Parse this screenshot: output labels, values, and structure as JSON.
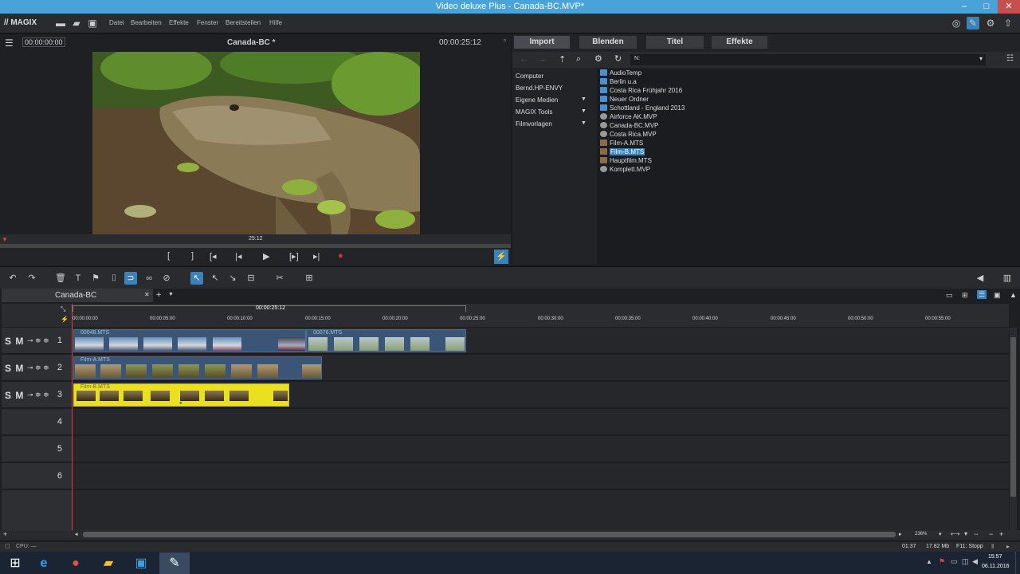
{
  "window": {
    "title": "Video deluxe Plus - Canada-BC.MVP*",
    "min": "–",
    "max": "□",
    "close": "✕"
  },
  "menubar": {
    "logo": "// MAGIX",
    "items": [
      "Datei",
      "Bearbeiten",
      "Effekte",
      "Fenster",
      "Bereitstellen",
      "Hilfe"
    ]
  },
  "preview": {
    "timecode_left": "00:00:00:00",
    "title": "Canada-BC *",
    "timecode_right": "00:00:25:12",
    "scrub_label": "25:12"
  },
  "media": {
    "tabs": [
      "Import",
      "Blenden",
      "Titel",
      "Effekte"
    ],
    "path": "N:",
    "tree": [
      "Computer",
      "Bernd.HP-ENVY",
      "Eigene Medien",
      "MAGIX Tools",
      "Filmvorlagen"
    ],
    "files": [
      {
        "name": "AudioTemp",
        "kind": "folder"
      },
      {
        "name": "Berlin u.a",
        "kind": "folder"
      },
      {
        "name": "Costa Rica Frühjahr 2016",
        "kind": "folder"
      },
      {
        "name": "Neuer Ordner",
        "kind": "folder"
      },
      {
        "name": "Schottland - England 2013",
        "kind": "folder"
      },
      {
        "name": "Airforce AK.MVP",
        "kind": "project"
      },
      {
        "name": "Canada-BC.MVP",
        "kind": "project"
      },
      {
        "name": "Costa Rica.MVP",
        "kind": "project"
      },
      {
        "name": "Film-A.MTS",
        "kind": "video"
      },
      {
        "name": "Film-B.MTS",
        "kind": "video",
        "selected": true
      },
      {
        "name": "Hauptfilm.MTS",
        "kind": "video"
      },
      {
        "name": "Komplett.MVP",
        "kind": "project"
      }
    ]
  },
  "timeline": {
    "tab": "Canada-BC",
    "add": "+",
    "range_label": "00:00:25:12",
    "ruler": [
      "00:00:00:00",
      "00:00:05:00",
      "00:00:10:00",
      "00:00:15:00",
      "00:00:20:00",
      "00:00:25:00",
      "00:00:30:00",
      "00:00:35:00",
      "00:00:40:00",
      "00:00:45:00",
      "00:00:50:00",
      "00:00:55:00"
    ],
    "track_ctrl": "S M",
    "tracks": [
      "1",
      "2",
      "3",
      "4",
      "5",
      "6"
    ],
    "clips": {
      "t1a": "00048.MTS",
      "t1b": "00076.MTS",
      "t2": "Film-A.MTS",
      "t3": "Film-B.MTS"
    },
    "zoom": "236%"
  },
  "status": {
    "cpu": "CPU: —",
    "time": "01:37",
    "size": "17.82 Mb",
    "f11": "F11: Stopp"
  },
  "taskbar": {
    "clock": "15:57",
    "date": "06.11.2016"
  }
}
